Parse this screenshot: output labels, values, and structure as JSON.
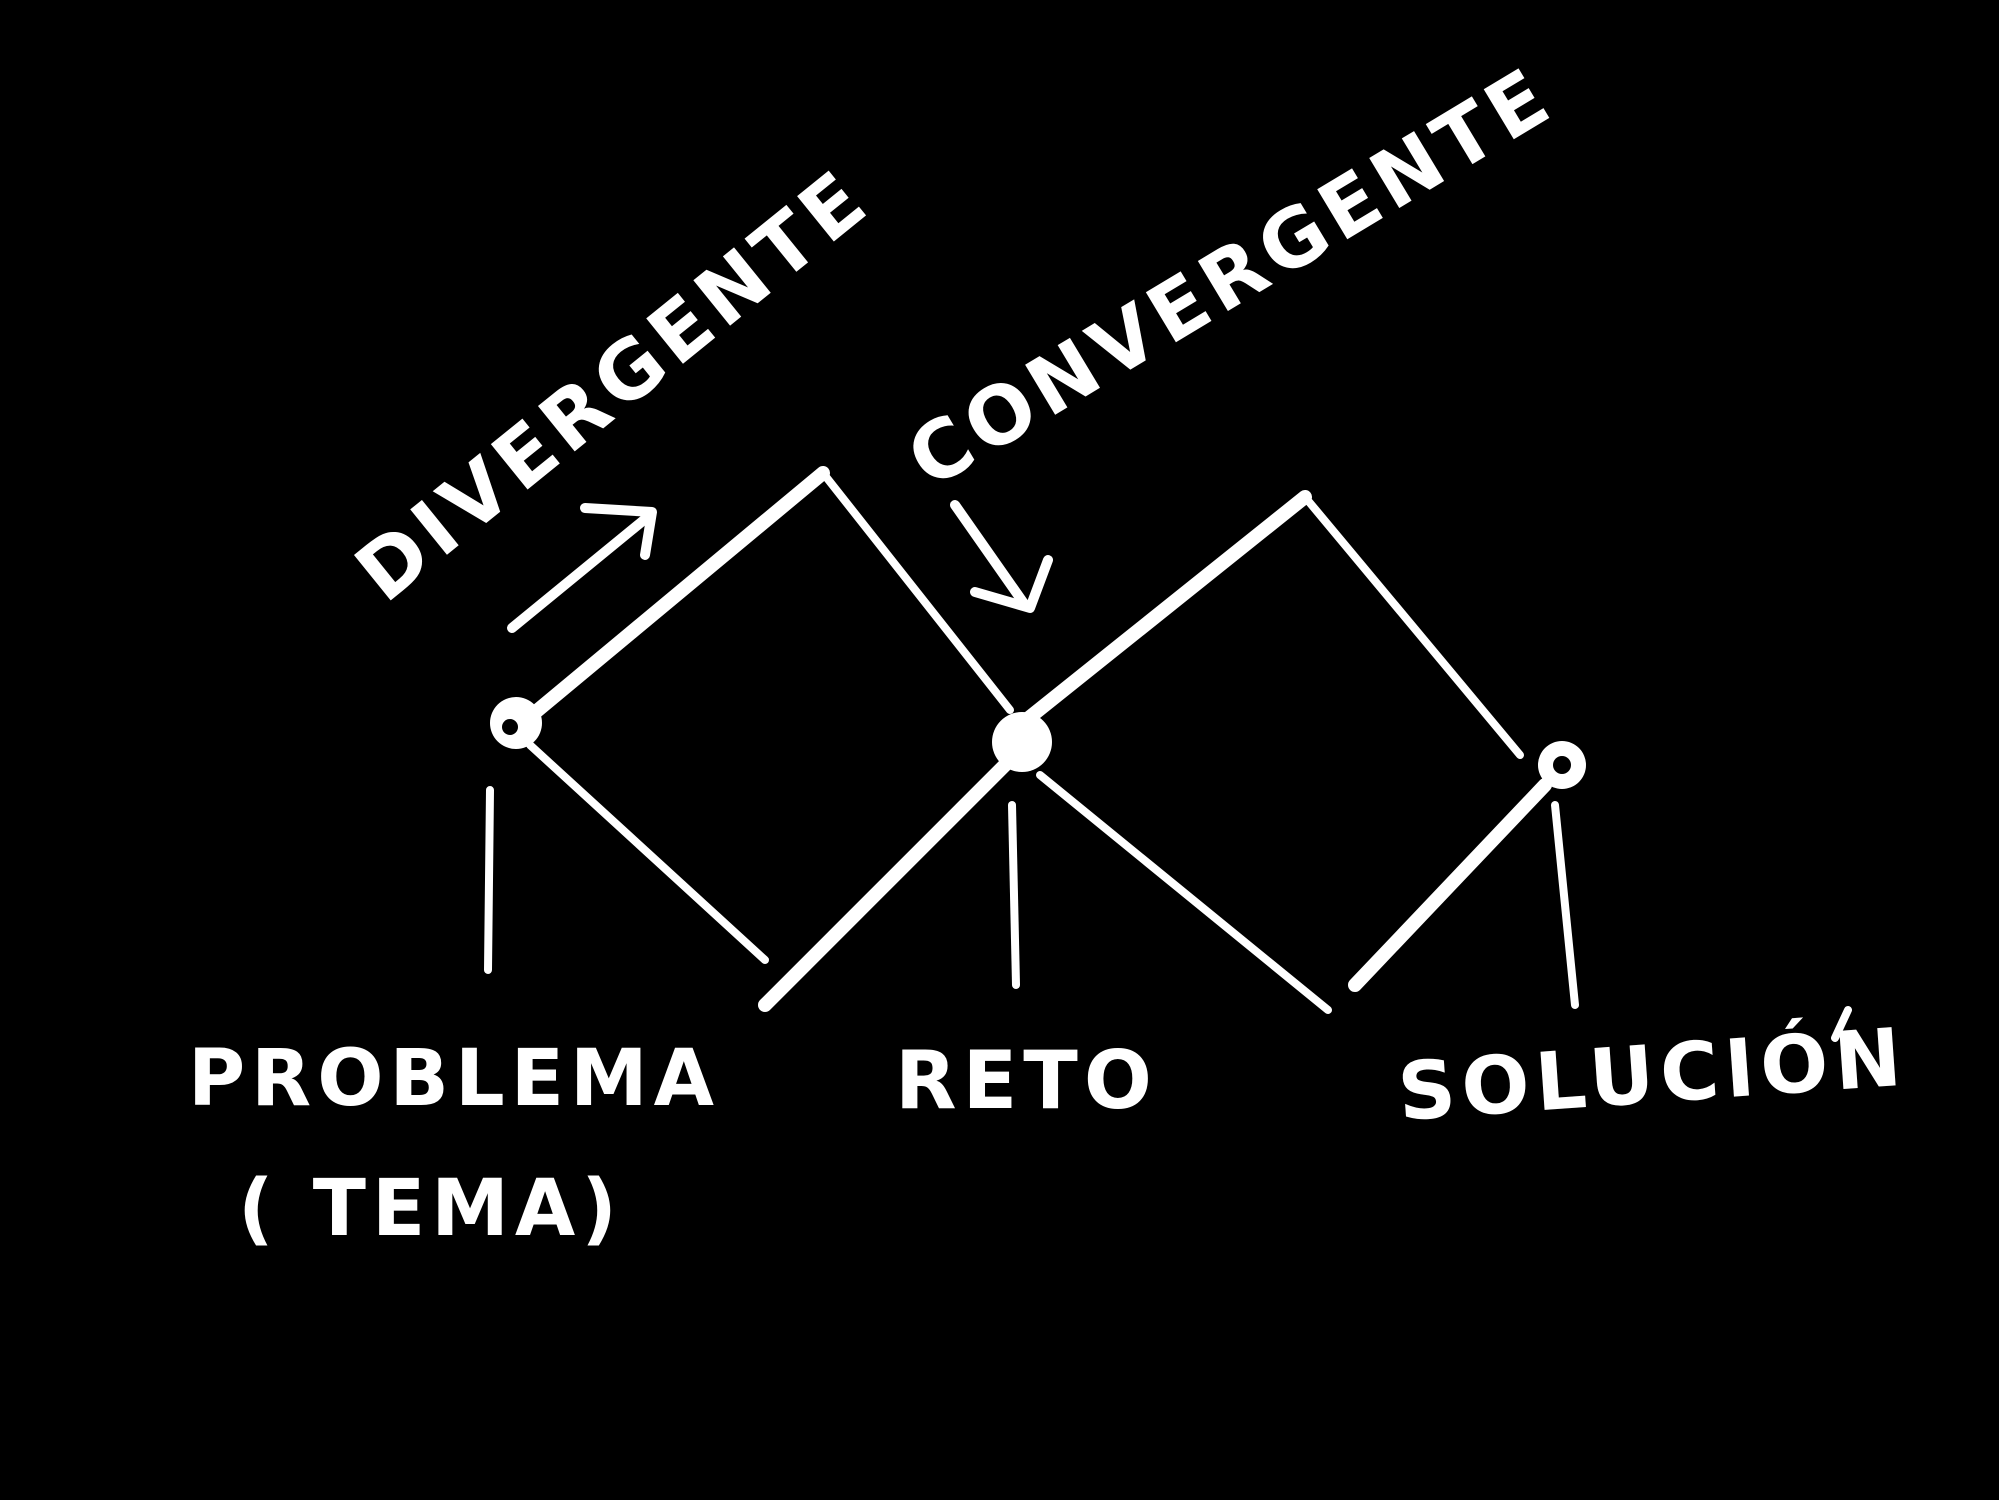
{
  "diagram": {
    "title": "",
    "colors": {
      "background": "#000000",
      "ink": "#ffffff"
    },
    "phases": {
      "divergent": "DIVERGENTE",
      "convergent": "CONVERGENTE"
    },
    "stages": {
      "problem": "PROBLEMA",
      "problem_note": "( TEMA)",
      "challenge": "RETO",
      "solution": "SOLUCIÓN"
    },
    "icons": {
      "divergent_arrow": "arrow-up-right-icon",
      "convergent_arrow": "arrow-down-icon"
    }
  }
}
